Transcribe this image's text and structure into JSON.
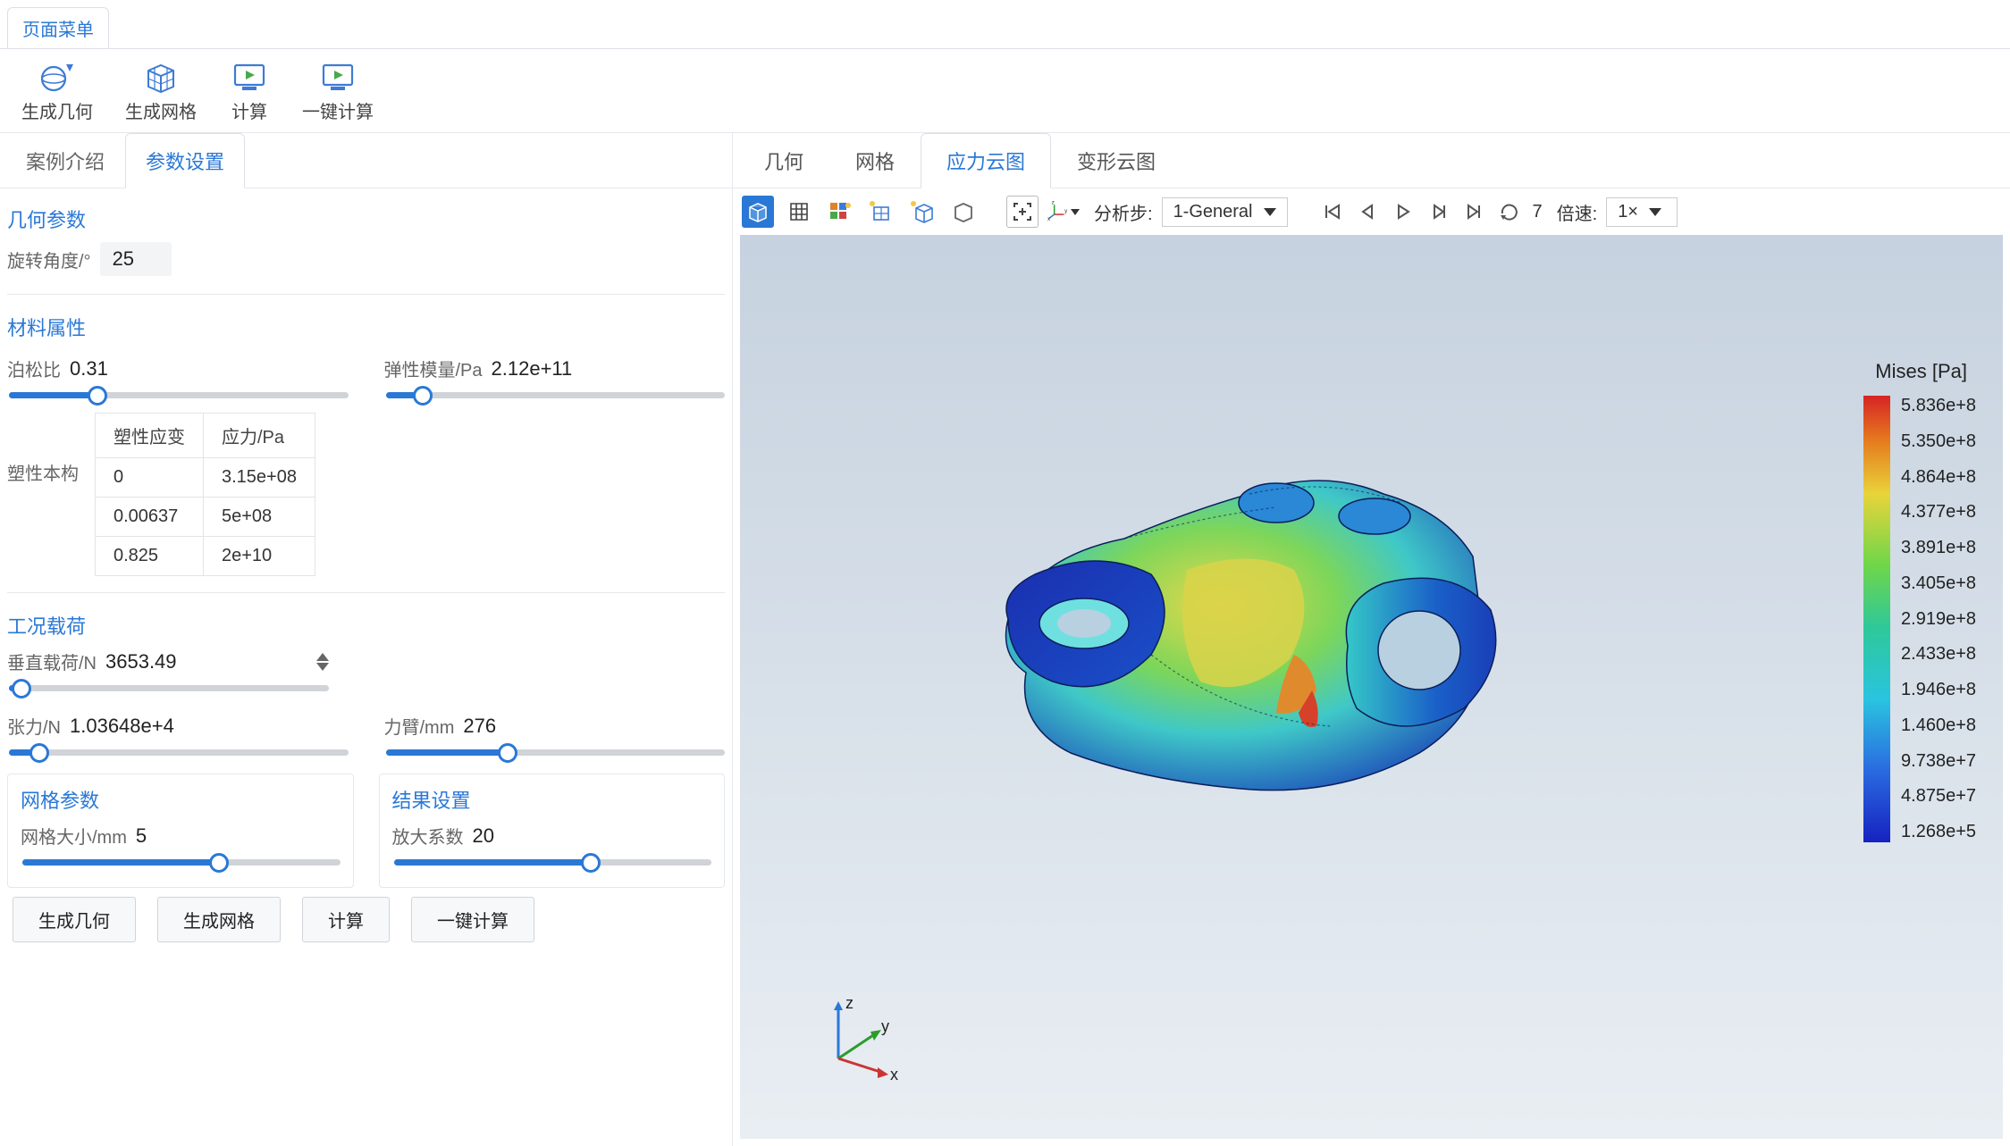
{
  "top_tab": "页面菜单",
  "ribbon": [
    {
      "label": "生成几何",
      "icon": "sphere"
    },
    {
      "label": "生成网格",
      "icon": "cube"
    },
    {
      "label": "计算",
      "icon": "play-monitor"
    },
    {
      "label": "一键计算",
      "icon": "play-monitor"
    }
  ],
  "left_tabs": {
    "items": [
      "案例介绍",
      "参数设置"
    ],
    "active": 1
  },
  "sections": {
    "geom": {
      "title": "几何参数",
      "rotation": {
        "label": "旋转角度/° ",
        "value": "25"
      }
    },
    "material": {
      "title": "材料属性",
      "poisson": {
        "label": "泊松比",
        "value": "0.31",
        "pct": 26
      },
      "young": {
        "label": "弹性模量/Pa",
        "value": "2.12e+11",
        "pct": 11
      },
      "plastic_label": "塑性本构",
      "th": [
        "塑性应变",
        "应力/Pa"
      ],
      "rows": [
        [
          "0",
          "3.15e+08"
        ],
        [
          "0.00637",
          "5e+08"
        ],
        [
          "0.825",
          "2e+10"
        ]
      ]
    },
    "load": {
      "title": "工况载荷",
      "vertical": {
        "label": "垂直载荷/N",
        "value": "3653.49",
        "pct": 4
      },
      "tension": {
        "label": "张力/N",
        "value": "1.03648e+4",
        "pct": 9
      },
      "arm": {
        "label": "力臂/mm",
        "value": "276",
        "pct": 36
      }
    },
    "mesh": {
      "title": "网格参数",
      "size": {
        "label": "网格大小/mm",
        "value": "5",
        "pct": 62
      }
    },
    "result": {
      "title": "结果设置",
      "scale": {
        "label": "放大系数",
        "value": "20",
        "pct": 62
      }
    }
  },
  "bottom_buttons": [
    "生成几何",
    "生成网格",
    "计算",
    "一键计算"
  ],
  "right_tabs": {
    "items": [
      "几何",
      "网格",
      "应力云图",
      "变形云图"
    ],
    "active": 2
  },
  "viewer": {
    "step_label": "分析步:",
    "step_value": "1-General",
    "frame": "7",
    "speed_label": "倍速:",
    "speed_value": "1×"
  },
  "legend": {
    "title": "Mises [Pa]",
    "values": [
      "5.836e+8",
      "5.350e+8",
      "4.864e+8",
      "4.377e+8",
      "3.891e+8",
      "3.405e+8",
      "2.919e+8",
      "2.433e+8",
      "1.946e+8",
      "1.460e+8",
      "9.738e+7",
      "4.875e+7",
      "1.268e+5"
    ]
  }
}
